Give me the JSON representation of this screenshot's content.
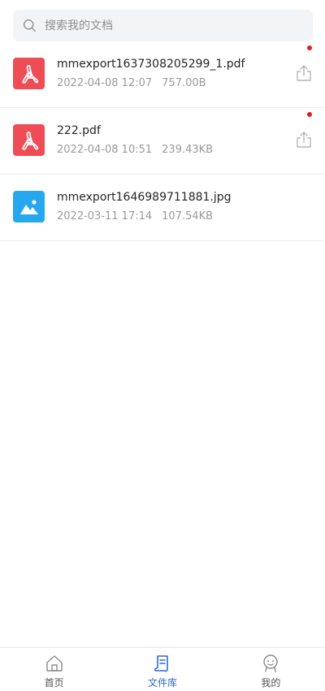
{
  "search": {
    "placeholder": "搜索我的文档",
    "icon": "search-icon"
  },
  "files": [
    {
      "name": "mmexport1637308205299_1.pdf",
      "date": "2022-04-08 12:07",
      "size": "757.00B",
      "type": "pdf",
      "icon": "pdf-file-icon",
      "has_share": true,
      "has_dot": true
    },
    {
      "name": "222.pdf",
      "date": "2022-04-08 10:51",
      "size": "239.43KB",
      "type": "pdf",
      "icon": "pdf-file-icon",
      "has_share": true,
      "has_dot": true
    },
    {
      "name": "mmexport1646989711881.jpg",
      "date": "2022-03-11 17:14",
      "size": "107.54KB",
      "type": "image",
      "icon": "image-file-icon",
      "has_share": false,
      "has_dot": false
    }
  ],
  "tabbar": {
    "items": [
      {
        "label": "首页",
        "icon": "home-icon",
        "active": false
      },
      {
        "label": "文件库",
        "icon": "file-library-icon",
        "active": true
      },
      {
        "label": "我的",
        "icon": "profile-icon",
        "active": false
      }
    ]
  },
  "colors": {
    "pdf": "#ef4d55",
    "image": "#26a8ee",
    "accent": "#2d6ad9",
    "notification_dot": "#e01c1c"
  }
}
